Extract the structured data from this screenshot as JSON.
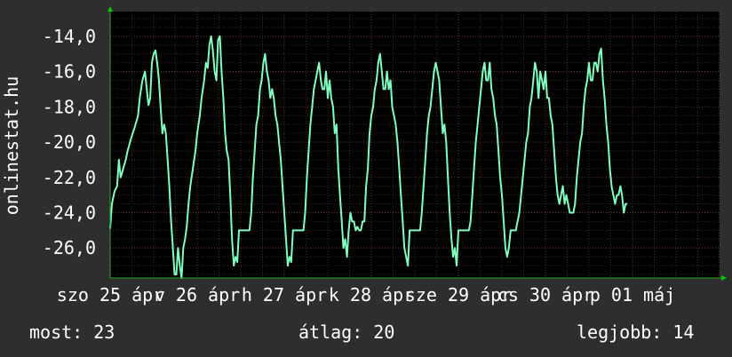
{
  "chart_data": {
    "type": "line",
    "ylabel": "onlinestat.hu",
    "ylim": [
      -27.7,
      -12.6
    ],
    "yticks": [
      -14,
      -16,
      -18,
      -20,
      -22,
      -24,
      -26
    ],
    "ytick_labels": [
      "-14,0",
      "-16,0",
      "-18,0",
      "-20,0",
      "-22,0",
      "-24,0",
      "-26,0"
    ],
    "xlim": [
      0,
      7.0
    ],
    "xticks": [
      0,
      1,
      2,
      3,
      4,
      5,
      6
    ],
    "xtick_labels": [
      "szo 25 ápr",
      "v 26 ápr",
      "h 27 ápr",
      "k 28 ápr",
      "sze 29 ápr",
      "cs 30 ápr",
      "p 01 máj"
    ],
    "grid": true,
    "colors": {
      "background": "#2e2e2e",
      "plot": "#000000",
      "line": "#7fffbf",
      "grid": "#5a3030",
      "axis_arrow": "#00cc00"
    },
    "series": [
      {
        "values": [
          [
            0.0,
            -24.9
          ],
          [
            0.02,
            -23.5
          ],
          [
            0.05,
            -22.8
          ],
          [
            0.08,
            -22.5
          ],
          [
            0.1,
            -21.0
          ],
          [
            0.12,
            -22.0
          ],
          [
            0.15,
            -21.5
          ],
          [
            0.18,
            -21.0
          ],
          [
            0.2,
            -20.5
          ],
          [
            0.24,
            -19.8
          ],
          [
            0.28,
            -19.2
          ],
          [
            0.32,
            -18.5
          ],
          [
            0.34,
            -17.5
          ],
          [
            0.37,
            -16.5
          ],
          [
            0.4,
            -16.0
          ],
          [
            0.42,
            -17.0
          ],
          [
            0.44,
            -17.9
          ],
          [
            0.46,
            -17.5
          ],
          [
            0.48,
            -15.5
          ],
          [
            0.5,
            -15.0
          ],
          [
            0.52,
            -14.8
          ],
          [
            0.54,
            -15.5
          ],
          [
            0.56,
            -16.5
          ],
          [
            0.58,
            -18.0
          ],
          [
            0.6,
            -19.5
          ],
          [
            0.62,
            -19.0
          ],
          [
            0.64,
            -19.5
          ],
          [
            0.66,
            -21.0
          ],
          [
            0.68,
            -22.5
          ],
          [
            0.7,
            -24.5
          ],
          [
            0.72,
            -26.0
          ],
          [
            0.74,
            -27.5
          ],
          [
            0.76,
            -27.5
          ],
          [
            0.78,
            -26.0
          ],
          [
            0.8,
            -27.0
          ],
          [
            0.82,
            -27.7
          ],
          [
            0.84,
            -26.0
          ],
          [
            0.86,
            -25.5
          ],
          [
            0.88,
            -24.8
          ],
          [
            0.9,
            -23.5
          ],
          [
            0.92,
            -22.5
          ],
          [
            0.95,
            -21.5
          ],
          [
            0.98,
            -20.5
          ],
          [
            1.0,
            -19.5
          ],
          [
            1.03,
            -18.5
          ],
          [
            1.05,
            -17.5
          ],
          [
            1.08,
            -16.5
          ],
          [
            1.1,
            -15.5
          ],
          [
            1.12,
            -15.8
          ],
          [
            1.14,
            -14.5
          ],
          [
            1.16,
            -14.0
          ],
          [
            1.18,
            -14.8
          ],
          [
            1.2,
            -16.0
          ],
          [
            1.22,
            -16.5
          ],
          [
            1.24,
            -14.2
          ],
          [
            1.26,
            -14.0
          ],
          [
            1.28,
            -16.0
          ],
          [
            1.3,
            -17.5
          ],
          [
            1.32,
            -19.5
          ],
          [
            1.34,
            -20.5
          ],
          [
            1.36,
            -21.0
          ],
          [
            1.38,
            -23.0
          ],
          [
            1.4,
            -25.5
          ],
          [
            1.42,
            -27.0
          ],
          [
            1.44,
            -26.5
          ],
          [
            1.46,
            -26.8
          ],
          [
            1.48,
            -25.0
          ],
          [
            1.52,
            -25.0
          ],
          [
            1.56,
            -25.0
          ],
          [
            1.6,
            -25.0
          ],
          [
            1.62,
            -24.0
          ],
          [
            1.64,
            -22.0
          ],
          [
            1.66,
            -20.5
          ],
          [
            1.68,
            -19.0
          ],
          [
            1.7,
            -18.5
          ],
          [
            1.72,
            -17.0
          ],
          [
            1.74,
            -16.5
          ],
          [
            1.76,
            -15.5
          ],
          [
            1.78,
            -15.0
          ],
          [
            1.8,
            -16.0
          ],
          [
            1.82,
            -16.5
          ],
          [
            1.84,
            -17.5
          ],
          [
            1.86,
            -17.0
          ],
          [
            1.88,
            -17.5
          ],
          [
            1.9,
            -18.5
          ],
          [
            1.92,
            -19.0
          ],
          [
            1.94,
            -20.0
          ],
          [
            1.96,
            -21.0
          ],
          [
            1.98,
            -22.5
          ],
          [
            2.0,
            -24.0
          ],
          [
            2.02,
            -25.5
          ],
          [
            2.04,
            -27.0
          ],
          [
            2.06,
            -26.5
          ],
          [
            2.08,
            -26.8
          ],
          [
            2.1,
            -25.0
          ],
          [
            2.14,
            -25.0
          ],
          [
            2.18,
            -25.0
          ],
          [
            2.22,
            -25.0
          ],
          [
            2.24,
            -24.0
          ],
          [
            2.26,
            -22.0
          ],
          [
            2.28,
            -20.5
          ],
          [
            2.3,
            -19.0
          ],
          [
            2.32,
            -18.0
          ],
          [
            2.34,
            -17.0
          ],
          [
            2.36,
            -16.5
          ],
          [
            2.38,
            -16.0
          ],
          [
            2.4,
            -15.5
          ],
          [
            2.42,
            -16.5
          ],
          [
            2.44,
            -17.0
          ],
          [
            2.46,
            -17.0
          ],
          [
            2.48,
            -16.0
          ],
          [
            2.5,
            -17.5
          ],
          [
            2.52,
            -16.5
          ],
          [
            2.54,
            -17.5
          ],
          [
            2.56,
            -18.0
          ],
          [
            2.58,
            -19.5
          ],
          [
            2.6,
            -19.0
          ],
          [
            2.62,
            -21.5
          ],
          [
            2.64,
            -23.0
          ],
          [
            2.66,
            -24.5
          ],
          [
            2.68,
            -26.0
          ],
          [
            2.7,
            -25.5
          ],
          [
            2.72,
            -26.5
          ],
          [
            2.74,
            -25.0
          ],
          [
            2.76,
            -24.0
          ],
          [
            2.78,
            -24.5
          ],
          [
            2.8,
            -24.5
          ],
          [
            2.82,
            -25.0
          ],
          [
            2.84,
            -24.8
          ],
          [
            2.86,
            -25.0
          ],
          [
            2.88,
            -25.0
          ],
          [
            2.9,
            -24.5
          ],
          [
            2.92,
            -24.5
          ],
          [
            2.94,
            -22.5
          ],
          [
            2.96,
            -21.5
          ],
          [
            2.98,
            -19.5
          ],
          [
            3.0,
            -18.5
          ],
          [
            3.02,
            -18.0
          ],
          [
            3.04,
            -17.0
          ],
          [
            3.06,
            -16.5
          ],
          [
            3.08,
            -15.5
          ],
          [
            3.1,
            -15.0
          ],
          [
            3.12,
            -16.0
          ],
          [
            3.14,
            -17.0
          ],
          [
            3.16,
            -17.0
          ],
          [
            3.18,
            -16.0
          ],
          [
            3.2,
            -17.0
          ],
          [
            3.22,
            -16.5
          ],
          [
            3.24,
            -18.0
          ],
          [
            3.26,
            -18.5
          ],
          [
            3.28,
            -19.0
          ],
          [
            3.3,
            -20.0
          ],
          [
            3.32,
            -21.5
          ],
          [
            3.34,
            -23.0
          ],
          [
            3.36,
            -24.5
          ],
          [
            3.38,
            -26.0
          ],
          [
            3.4,
            -26.5
          ],
          [
            3.42,
            -27.0
          ],
          [
            3.44,
            -25.0
          ],
          [
            3.48,
            -25.0
          ],
          [
            3.52,
            -25.0
          ],
          [
            3.56,
            -25.0
          ],
          [
            3.58,
            -24.0
          ],
          [
            3.6,
            -22.5
          ],
          [
            3.62,
            -21.0
          ],
          [
            3.64,
            -19.5
          ],
          [
            3.66,
            -18.5
          ],
          [
            3.68,
            -18.0
          ],
          [
            3.7,
            -17.0
          ],
          [
            3.72,
            -16.0
          ],
          [
            3.74,
            -15.5
          ],
          [
            3.76,
            -16.0
          ],
          [
            3.78,
            -16.5
          ],
          [
            3.8,
            -18.0
          ],
          [
            3.82,
            -19.5
          ],
          [
            3.84,
            -19.0
          ],
          [
            3.86,
            -20.0
          ],
          [
            3.88,
            -22.0
          ],
          [
            3.9,
            -24.0
          ],
          [
            3.92,
            -25.5
          ],
          [
            3.94,
            -26.5
          ],
          [
            3.96,
            -26.0
          ],
          [
            3.98,
            -27.0
          ],
          [
            4.0,
            -25.0
          ],
          [
            4.04,
            -25.0
          ],
          [
            4.08,
            -25.0
          ],
          [
            4.12,
            -25.0
          ],
          [
            4.14,
            -24.5
          ],
          [
            4.16,
            -23.0
          ],
          [
            4.18,
            -21.5
          ],
          [
            4.2,
            -20.0
          ],
          [
            4.22,
            -19.0
          ],
          [
            4.24,
            -18.0
          ],
          [
            4.26,
            -17.0
          ],
          [
            4.28,
            -16.0
          ],
          [
            4.3,
            -15.5
          ],
          [
            4.32,
            -16.5
          ],
          [
            4.34,
            -16.5
          ],
          [
            4.36,
            -15.5
          ],
          [
            4.38,
            -17.0
          ],
          [
            4.4,
            -17.5
          ],
          [
            4.42,
            -18.5
          ],
          [
            4.44,
            -19.0
          ],
          [
            4.46,
            -20.5
          ],
          [
            4.48,
            -22.0
          ],
          [
            4.5,
            -23.0
          ],
          [
            4.52,
            -24.5
          ],
          [
            4.54,
            -26.0
          ],
          [
            4.56,
            -26.5
          ],
          [
            4.58,
            -26.0
          ],
          [
            4.6,
            -25.0
          ],
          [
            4.64,
            -25.0
          ],
          [
            4.66,
            -25.0
          ],
          [
            4.68,
            -24.5
          ],
          [
            4.7,
            -24.0
          ],
          [
            4.72,
            -23.0
          ],
          [
            4.74,
            -22.0
          ],
          [
            4.76,
            -21.0
          ],
          [
            4.78,
            -20.0
          ],
          [
            4.8,
            -19.5
          ],
          [
            4.82,
            -18.0
          ],
          [
            4.84,
            -17.5
          ],
          [
            4.86,
            -16.5
          ],
          [
            4.88,
            -15.5
          ],
          [
            4.9,
            -16.0
          ],
          [
            4.92,
            -17.5
          ],
          [
            4.94,
            -16.0
          ],
          [
            4.96,
            -16.5
          ],
          [
            4.98,
            -17.0
          ],
          [
            5.0,
            -16.0
          ],
          [
            5.02,
            -17.5
          ],
          [
            5.04,
            -17.5
          ],
          [
            5.06,
            -18.5
          ],
          [
            5.08,
            -19.0
          ],
          [
            5.1,
            -20.5
          ],
          [
            5.12,
            -22.0
          ],
          [
            5.14,
            -23.0
          ],
          [
            5.16,
            -23.5
          ],
          [
            5.18,
            -23.0
          ],
          [
            5.2,
            -22.5
          ],
          [
            5.22,
            -23.5
          ],
          [
            5.24,
            -23.0
          ],
          [
            5.26,
            -23.5
          ],
          [
            5.28,
            -24.0
          ],
          [
            5.3,
            -24.0
          ],
          [
            5.32,
            -24.0
          ],
          [
            5.34,
            -23.5
          ],
          [
            5.36,
            -22.0
          ],
          [
            5.38,
            -21.0
          ],
          [
            5.4,
            -20.0
          ],
          [
            5.42,
            -19.5
          ],
          [
            5.44,
            -18.0
          ],
          [
            5.46,
            -17.0
          ],
          [
            5.48,
            -16.5
          ],
          [
            5.5,
            -15.5
          ],
          [
            5.52,
            -16.5
          ],
          [
            5.54,
            -16.5
          ],
          [
            5.56,
            -15.5
          ],
          [
            5.58,
            -15.5
          ],
          [
            5.6,
            -16.0
          ],
          [
            5.62,
            -15.0
          ],
          [
            5.64,
            -14.7
          ],
          [
            5.66,
            -16.5
          ],
          [
            5.68,
            -17.5
          ],
          [
            5.7,
            -19.0
          ],
          [
            5.72,
            -20.0
          ],
          [
            5.74,
            -21.5
          ],
          [
            5.76,
            -22.5
          ],
          [
            5.78,
            -23.0
          ],
          [
            5.8,
            -23.5
          ],
          [
            5.82,
            -23.0
          ],
          [
            5.84,
            -23.0
          ],
          [
            5.86,
            -22.5
          ],
          [
            5.88,
            -23.0
          ],
          [
            5.9,
            -24.0
          ],
          [
            5.92,
            -23.5
          ],
          [
            5.94,
            -23.5
          ]
        ]
      }
    ],
    "stats": {
      "now": "most: 23",
      "average": "átlag: 20",
      "best": "legjobb: 14"
    }
  }
}
